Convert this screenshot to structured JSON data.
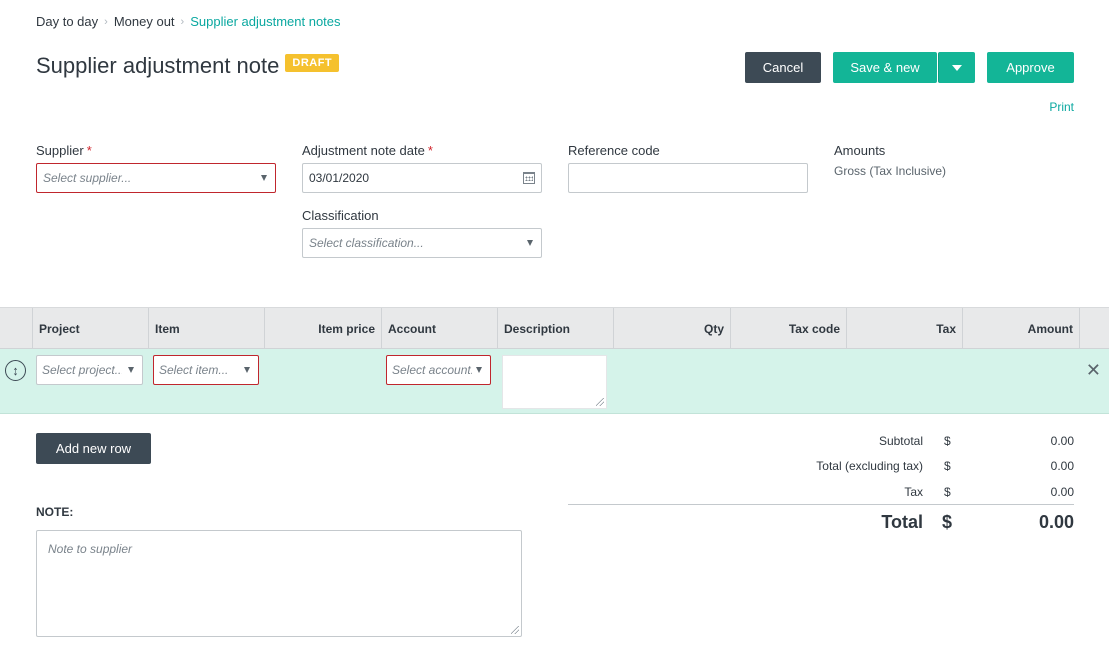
{
  "breadcrumb": {
    "items": [
      "Day to day",
      "Money out",
      "Supplier adjustment notes"
    ],
    "sep": "›"
  },
  "page": {
    "title": "Supplier adjustment note",
    "status_badge": "DRAFT"
  },
  "toolbar": {
    "cancel_label": "Cancel",
    "save_new_label": "Save & new",
    "approve_label": "Approve",
    "print_label": "Print"
  },
  "form": {
    "supplier": {
      "label": "Supplier",
      "required_mark": "*",
      "placeholder": "Select supplier..."
    },
    "date": {
      "label": "Adjustment note date",
      "required_mark": "*",
      "value": "03/01/2020"
    },
    "reference": {
      "label": "Reference code",
      "value": ""
    },
    "amounts": {
      "label": "Amounts",
      "value": "Gross (Tax Inclusive)"
    },
    "classification": {
      "label": "Classification",
      "placeholder": "Select classification..."
    }
  },
  "grid": {
    "columns": [
      "Project",
      "Item",
      "Item price",
      "Account",
      "Description",
      "Qty",
      "Tax code",
      "Tax",
      "Amount"
    ],
    "row": {
      "drag_icon": "↕",
      "project_placeholder": "Select project...",
      "item_placeholder": "Select item...",
      "account_placeholder": "Select account...",
      "remove_icon": "✕"
    },
    "add_row_label": "Add new row"
  },
  "note": {
    "label": "NOTE:",
    "placeholder": "Note to supplier"
  },
  "totals": {
    "currency": "$",
    "subtotal_label": "Subtotal",
    "subtotal": "0.00",
    "excl_label": "Total (excluding tax)",
    "excl": "0.00",
    "tax_label": "Tax",
    "tax": "0.00",
    "total_label": "Total",
    "total": "0.00"
  },
  "colors": {
    "accent": "#13b597",
    "link": "#0aa8a0",
    "dark_button": "#3d4a55",
    "badge": "#f5c12e",
    "row_highlight": "#d5f3ea",
    "error": "#c0262d"
  }
}
